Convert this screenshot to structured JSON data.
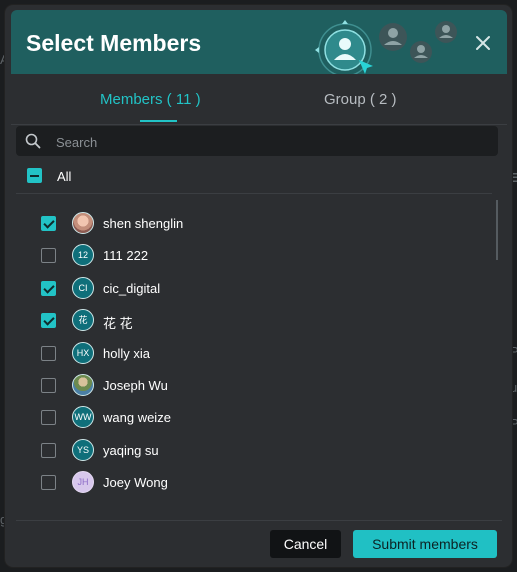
{
  "background": {
    "fragments": [
      "Ai",
      "E",
      "P",
      "u",
      "P",
      "g"
    ]
  },
  "dialog": {
    "title": "Select Members",
    "tabs": [
      {
        "label": "Members ( 11 )",
        "active": true
      },
      {
        "label": "Group ( 2 )",
        "active": false
      }
    ],
    "search": {
      "placeholder": "Search",
      "value": ""
    },
    "all_label": "All",
    "members": [
      {
        "name": "shen shenglin",
        "initials": "",
        "checked": true,
        "avatar": "photo"
      },
      {
        "name": "111 222",
        "initials": "12",
        "checked": false,
        "avatar": "initials"
      },
      {
        "name": "cic_digital",
        "initials": "CI",
        "checked": true,
        "avatar": "initials"
      },
      {
        "name": "花 花",
        "initials": "花",
        "checked": true,
        "avatar": "initials"
      },
      {
        "name": "holly xia",
        "initials": "HX",
        "checked": false,
        "avatar": "initials"
      },
      {
        "name": "Joseph Wu",
        "initials": "",
        "checked": false,
        "avatar": "photo"
      },
      {
        "name": "wang weize",
        "initials": "WW",
        "checked": false,
        "avatar": "initials"
      },
      {
        "name": "yaqing su",
        "initials": "YS",
        "checked": false,
        "avatar": "initials"
      },
      {
        "name": "Joey Wong",
        "initials": "JH",
        "checked": false,
        "avatar": "initials-light"
      }
    ],
    "buttons": {
      "cancel": "Cancel",
      "submit": "Submit members"
    },
    "colors": {
      "accent": "#22c3c6",
      "header": "#1f5f5f",
      "dialog_bg": "#2c2e31"
    }
  }
}
